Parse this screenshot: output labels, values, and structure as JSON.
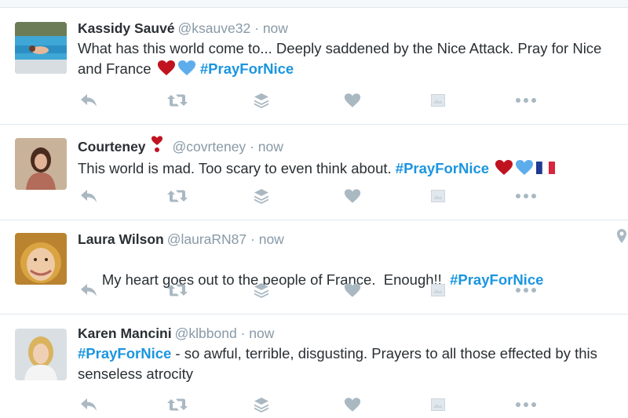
{
  "tweets": [
    {
      "fullname": "Kassidy Sauvé",
      "handle": "@ksauve32",
      "time": "now",
      "separator": "·",
      "text_before": "What has this world come to... Deeply saddened by the Nice Attack. Pray for Nice and France ",
      "hashtag": "#PrayForNice",
      "text_after": "",
      "emojis_before_hashtag": [
        "red-heart-icon",
        "blue-heart-icon"
      ],
      "emojis_after_hashtag": []
    },
    {
      "fullname": "Courteney",
      "handle": "@covrteney",
      "time": "now",
      "separator": "·",
      "badge": "heart-exclamation-icon",
      "text_before": "This world is mad. Too scary to even think about. ",
      "hashtag": "#PrayForNice",
      "text_after": "",
      "emojis_before_hashtag": [],
      "emojis_after_hashtag": [
        "red-heart-icon",
        "blue-heart-icon",
        "france-flag-icon"
      ]
    },
    {
      "fullname": "Laura Wilson",
      "handle": "@lauraRN87",
      "time": "now",
      "separator": "·",
      "text_before": "My heart goes out to the people of France.  Enough!!  ",
      "hashtag": "#PrayForNice",
      "text_after": "",
      "emojis_before_hashtag": [],
      "emojis_after_hashtag": []
    },
    {
      "fullname": "Karen Mancini",
      "handle": "@klbbond",
      "time": "now",
      "separator": "·",
      "text_before": "",
      "hashtag": "#PrayForNice",
      "text_after": " - so awful, terrible, disgusting. Prayers to all those effected by this senseless atrocity",
      "emojis_before_hashtag": [],
      "emojis_after_hashtag": []
    }
  ],
  "actions": [
    "reply-icon",
    "retweet-icon",
    "layers-icon",
    "like-icon",
    "media-icon",
    "more-icon"
  ],
  "colors": {
    "link": "#1b95e0",
    "muted": "#8899a6",
    "icon": "#aab8c2",
    "text": "#292f33",
    "red_heart": "#c1121f",
    "blue_heart": "#5dadec"
  }
}
